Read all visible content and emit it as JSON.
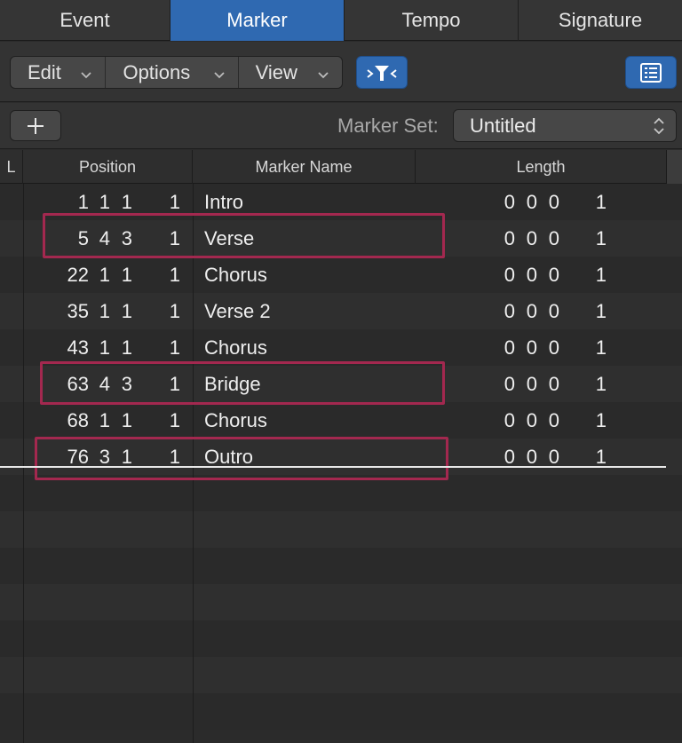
{
  "tabs": [
    {
      "label": "Event",
      "active": false
    },
    {
      "label": "Marker",
      "active": true
    },
    {
      "label": "Tempo",
      "active": false
    },
    {
      "label": "Signature",
      "active": false
    }
  ],
  "toolbar": {
    "edit_label": "Edit",
    "options_label": "Options",
    "view_label": "View",
    "filter_icon": "catch-filter-icon",
    "list_icon": "list-view-icon"
  },
  "marker_set": {
    "add_icon": "plus-icon",
    "label": "Marker Set:",
    "value": "Untitled"
  },
  "columns": {
    "lock": "L",
    "position": "Position",
    "name": "Marker Name",
    "length": "Length"
  },
  "rows": [
    {
      "pos_bar": "1",
      "pos_beat": "1",
      "pos_div": "1",
      "pos_tick": "1",
      "name": "Intro",
      "len_bar": "0",
      "len_beat": "0",
      "len_div": "0",
      "len_tick": "1",
      "highlighted": false
    },
    {
      "pos_bar": "5",
      "pos_beat": "4",
      "pos_div": "3",
      "pos_tick": "1",
      "name": "Verse",
      "len_bar": "0",
      "len_beat": "0",
      "len_div": "0",
      "len_tick": "1",
      "highlighted": true
    },
    {
      "pos_bar": "22",
      "pos_beat": "1",
      "pos_div": "1",
      "pos_tick": "1",
      "name": "Chorus",
      "len_bar": "0",
      "len_beat": "0",
      "len_div": "0",
      "len_tick": "1",
      "highlighted": false
    },
    {
      "pos_bar": "35",
      "pos_beat": "1",
      "pos_div": "1",
      "pos_tick": "1",
      "name": "Verse 2",
      "len_bar": "0",
      "len_beat": "0",
      "len_div": "0",
      "len_tick": "1",
      "highlighted": false
    },
    {
      "pos_bar": "43",
      "pos_beat": "1",
      "pos_div": "1",
      "pos_tick": "1",
      "name": "Chorus",
      "len_bar": "0",
      "len_beat": "0",
      "len_div": "0",
      "len_tick": "1",
      "highlighted": false
    },
    {
      "pos_bar": "63",
      "pos_beat": "4",
      "pos_div": "3",
      "pos_tick": "1",
      "name": "Bridge",
      "len_bar": "0",
      "len_beat": "0",
      "len_div": "0",
      "len_tick": "1",
      "highlighted": true
    },
    {
      "pos_bar": "68",
      "pos_beat": "1",
      "pos_div": "1",
      "pos_tick": "1",
      "name": "Chorus",
      "len_bar": "0",
      "len_beat": "0",
      "len_div": "0",
      "len_tick": "1",
      "highlighted": false
    },
    {
      "pos_bar": "76",
      "pos_beat": "3",
      "pos_div": "1",
      "pos_tick": "1",
      "name": "Outro",
      "len_bar": "0",
      "len_beat": "0",
      "len_div": "0",
      "len_tick": "1",
      "highlighted": true
    }
  ],
  "colors": {
    "accent": "#2f69b1",
    "highlight": "#a3284f"
  }
}
